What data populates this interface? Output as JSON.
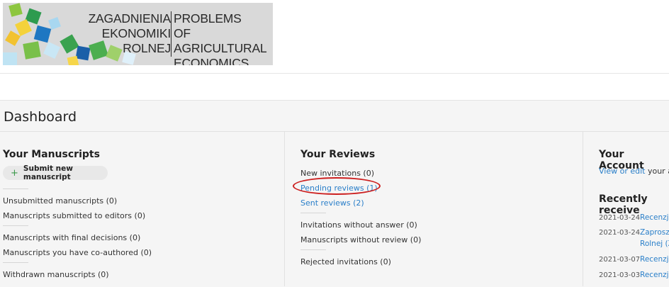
{
  "logo": {
    "left_lines": [
      "ZAGADNIENIA",
      "EKONOMIKI",
      "ROLNEJ"
    ],
    "right_lines": [
      "PROBLEMS",
      "OF AGRICULTURAL",
      "ECONOMICS"
    ]
  },
  "dashboard": {
    "title": "Dashboard"
  },
  "manuscripts": {
    "heading": "Your Manuscripts",
    "submit_label": "Submit new manuscript",
    "items": [
      "Unsubmitted manuscripts (0)",
      "Manuscripts submitted to editors (0)",
      "Manuscripts with final decisions (0)",
      "Manuscripts you have co-authored (0)",
      "Withdrawn manuscripts (0)"
    ]
  },
  "reviews": {
    "heading": "Your Reviews",
    "items": [
      "New invitations (0)",
      "Pending reviews (1)",
      "Sent reviews (2)",
      "Invitations without answer (0)",
      "Manuscripts without review (0)",
      "Rejected invitations (0)"
    ]
  },
  "account": {
    "heading": "Your Account",
    "view_edit_link": "View or edit",
    "view_edit_rest": "your acc",
    "recent_heading": "Recently receive",
    "notifications": [
      {
        "date": "2021-03-24",
        "text": "Recenzja"
      },
      {
        "date": "2021-03-24",
        "text": "Zaprosze",
        "text2": "Rolnej (Z"
      },
      {
        "date": "2021-03-07",
        "text": "Recenzja"
      },
      {
        "date": "2021-03-03",
        "text": "Recenzja"
      }
    ]
  },
  "colors": {
    "link": "#2a7fc9",
    "highlight_circle": "#cc1f1f",
    "plus": "#3b9a4a"
  }
}
